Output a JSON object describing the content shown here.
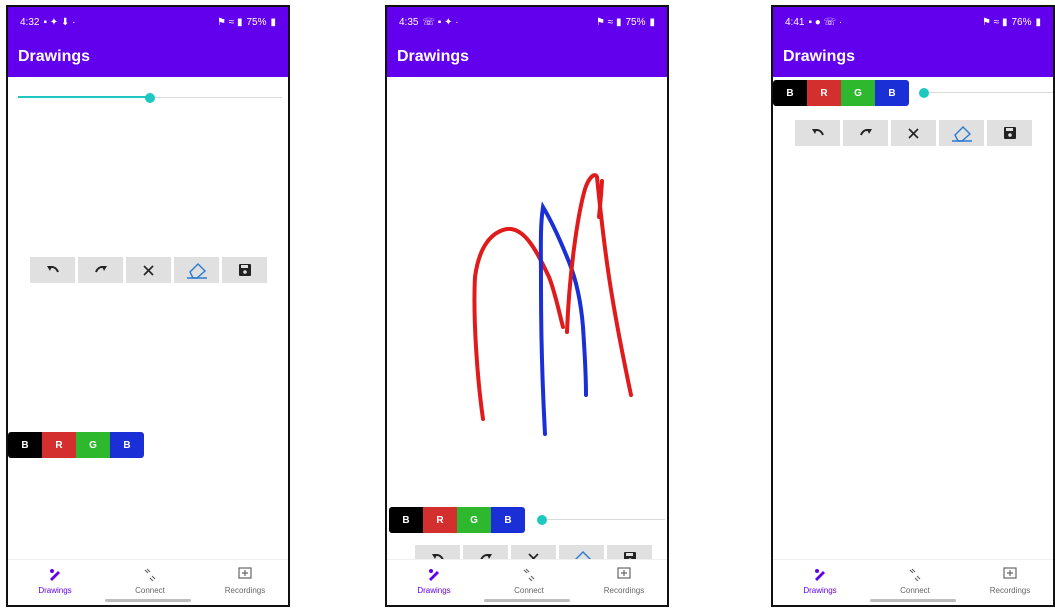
{
  "screens": [
    {
      "status": {
        "time": "4:32",
        "battery": "75%"
      },
      "title": "Drawings",
      "stroke_width_fraction": 0.5,
      "colors": [
        {
          "label": "B",
          "hex": "#000000"
        },
        {
          "label": "R",
          "hex": "#d32f2f"
        },
        {
          "label": "G",
          "hex": "#2eb82e"
        },
        {
          "label": "B",
          "hex": "#1a2fd6"
        }
      ],
      "tools": [
        "undo-icon",
        "redo-icon",
        "close-icon",
        "eraser-icon",
        "save-icon"
      ],
      "nav": [
        {
          "label": "Drawings",
          "icon": "draw-icon",
          "active": true
        },
        {
          "label": "Connect",
          "icon": "connect-icon",
          "active": false
        },
        {
          "label": "Recordings",
          "icon": "recordings-icon",
          "active": false
        }
      ]
    },
    {
      "status": {
        "time": "4:35",
        "battery": "75%"
      },
      "title": "Drawings",
      "stroke_width_fraction": 0.0,
      "colors": [
        {
          "label": "B",
          "hex": "#000000"
        },
        {
          "label": "R",
          "hex": "#d32f2f"
        },
        {
          "label": "G",
          "hex": "#2eb82e"
        },
        {
          "label": "B",
          "hex": "#1a2fd6"
        }
      ],
      "tools": [
        "undo-icon",
        "redo-icon",
        "close-icon",
        "eraser-icon",
        "save-icon"
      ],
      "nav": [
        {
          "label": "Drawings",
          "icon": "draw-icon",
          "active": true
        },
        {
          "label": "Connect",
          "icon": "connect-icon",
          "active": false
        },
        {
          "label": "Recordings",
          "icon": "recordings-icon",
          "active": false
        }
      ]
    },
    {
      "status": {
        "time": "4:41",
        "battery": "76%"
      },
      "title": "Drawings",
      "stroke_width_fraction": 0.0,
      "colors": [
        {
          "label": "B",
          "hex": "#000000"
        },
        {
          "label": "R",
          "hex": "#d32f2f"
        },
        {
          "label": "G",
          "hex": "#2eb82e"
        },
        {
          "label": "B",
          "hex": "#1a2fd6"
        }
      ],
      "tools": [
        "undo-icon",
        "redo-icon",
        "close-icon",
        "eraser-icon",
        "save-icon"
      ],
      "nav": [
        {
          "label": "Drawings",
          "icon": "draw-icon",
          "active": true
        },
        {
          "label": "Connect",
          "icon": "connect-icon",
          "active": false
        },
        {
          "label": "Recordings",
          "icon": "recordings-icon",
          "active": false
        }
      ]
    }
  ],
  "accent_colors": {
    "app_bar": "#6200ee",
    "slider": "#1ec8c0",
    "stroke_red": "#e01b1b",
    "stroke_blue": "#1a2fd6"
  }
}
